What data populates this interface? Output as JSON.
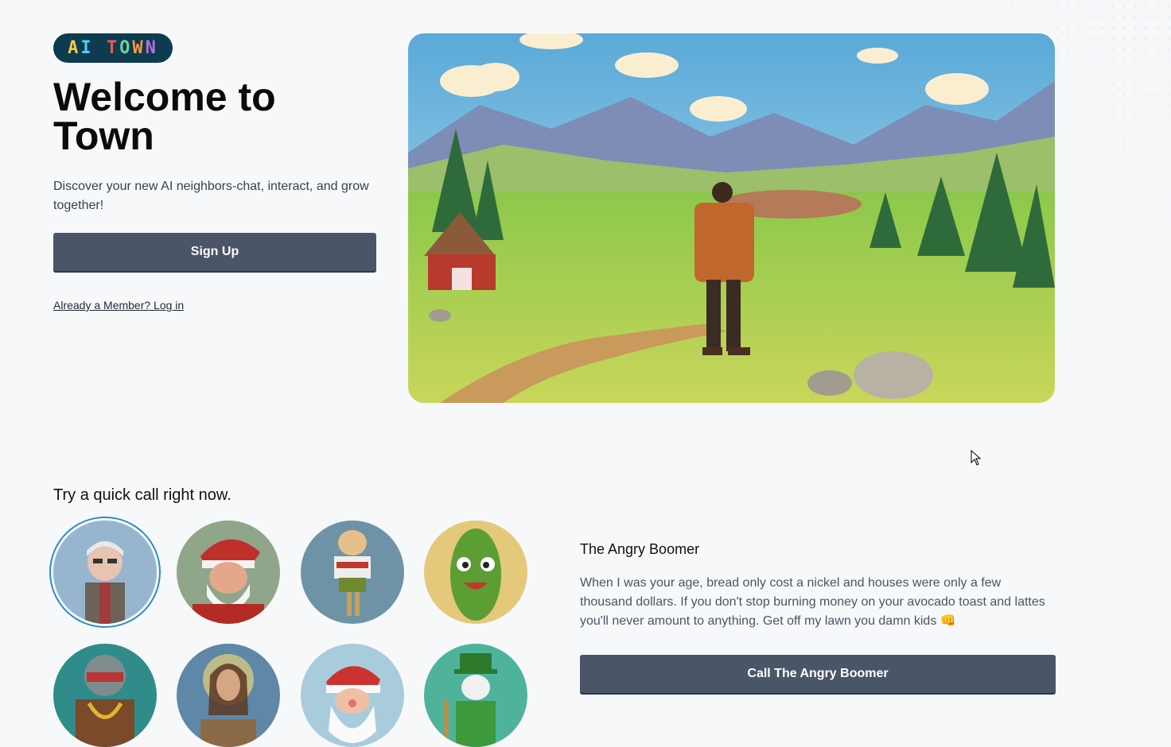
{
  "logo": {
    "text": "AI TOWN"
  },
  "hero": {
    "title": "Welcome to Town",
    "subtitle": "Discover your new AI neighbors-chat, interact, and grow together!",
    "signup_label": "Sign Up",
    "login_label": "Already a Member? Log in"
  },
  "quick_call": {
    "heading": "Try a quick call right now.",
    "avatars": [
      {
        "icon": "old-man-portrait-icon",
        "selected": true
      },
      {
        "icon": "angry-santa-portrait-icon",
        "selected": false
      },
      {
        "icon": "costco-mascot-portrait-icon",
        "selected": false
      },
      {
        "icon": "pickle-portrait-icon",
        "selected": false
      },
      {
        "icon": "robot-rapper-portrait-icon",
        "selected": false
      },
      {
        "icon": "jesus-portrait-icon",
        "selected": false
      },
      {
        "icon": "santa-portrait-icon",
        "selected": false
      },
      {
        "icon": "riddler-skeleton-portrait-icon",
        "selected": false
      }
    ],
    "selected_character": {
      "name": "The Angry Boomer",
      "description": "When I was your age, bread only cost a nickel and houses were only a few thousand dollars. If you don't stop burning money on your avocado toast and lattes you'll never amount to anything. Get off my lawn you damn kids 👊",
      "call_label": "Call The Angry Boomer"
    }
  },
  "colors": {
    "background": "#f7f8fa",
    "button": "#4a5568",
    "logo_bg": "#0d3b4f",
    "selected_ring": "#2b8dc9"
  }
}
